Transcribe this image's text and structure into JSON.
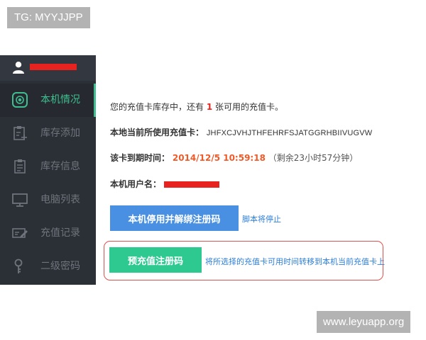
{
  "watermarks": {
    "top": "TG: MYYJJPP",
    "bottom": "www.leyuapp.org"
  },
  "sidebar": {
    "items": [
      {
        "label": "本机情况",
        "icon": "target-icon",
        "active": true
      },
      {
        "label": "库存添加",
        "icon": "clipboard-add-icon",
        "active": false
      },
      {
        "label": "库存信息",
        "icon": "clipboard-list-icon",
        "active": false
      },
      {
        "label": "电脑列表",
        "icon": "monitor-icon",
        "active": false
      },
      {
        "label": "充值记录",
        "icon": "card-edit-icon",
        "active": false
      },
      {
        "label": "二级密码",
        "icon": "key-icon",
        "active": false
      }
    ]
  },
  "main": {
    "inventory_prefix": "您的充值卡库存中，还有 ",
    "inventory_count": "1",
    "inventory_suffix": " 张可用的充值卡。",
    "current_card_label": "本地当前所使用充值卡：",
    "current_card_value": "JHFXCJVHJTHFEHRFSJATGGRHBIIVUGVW",
    "expiry_label": "该卡到期时间：",
    "expiry_value": "2014/12/5 10:59:18",
    "expiry_remaining": "（剩余23小时57分钟）",
    "username_label": "本机用户名："
  },
  "actions": {
    "unbind_button": "本机停用并解绑注册码",
    "unbind_note": "脚本将停止",
    "precharge_button": "预充值注册码",
    "precharge_hint": "将所选择的充值卡可用时间转移到本机当前充值卡上"
  },
  "colors": {
    "sidebar_bg": "#2b2f36",
    "accent_green": "#3fbf8f",
    "button_blue": "#4a90e2",
    "button_green": "#2ec991",
    "redaction_red": "#e8231f",
    "date_orange": "#f05a28",
    "link_blue": "#2e7fd8"
  }
}
